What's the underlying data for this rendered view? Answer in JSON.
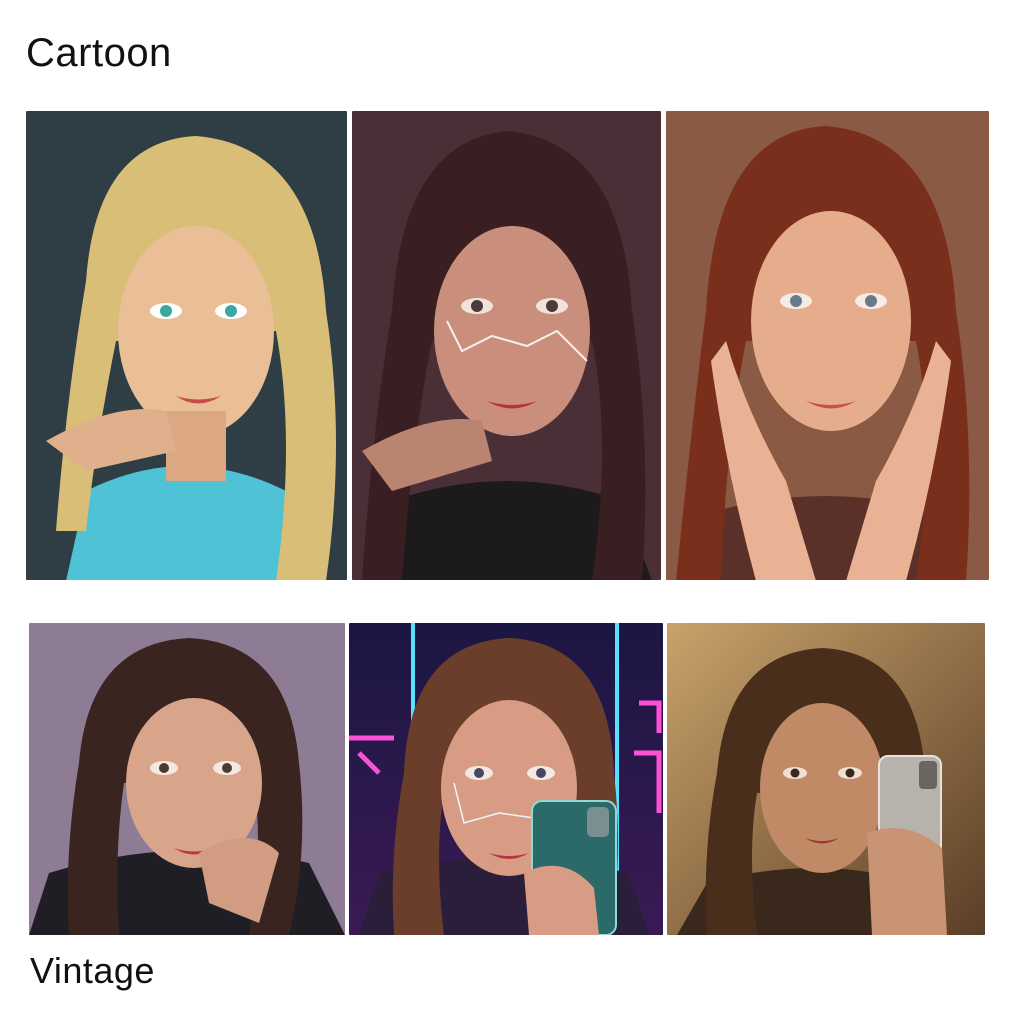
{
  "labels": {
    "top": "Cartoon",
    "bottom": "Vintage"
  },
  "tiles": [
    {
      "name": "blonde-freckles-portrait",
      "bg": "#2f3d45",
      "hair": "#d9be78",
      "skin": "#eabf97",
      "shirt": "#4fc2d6"
    },
    {
      "name": "brunette-cyber-lines-portrait",
      "bg": "#4a2f36",
      "hair": "#3a1f22",
      "skin": "#c98f7c",
      "shirt": "#1d1a1c"
    },
    {
      "name": "redhead-hands-on-cheeks-portrait",
      "bg": "#8a5a45",
      "hair": "#7a2f1c",
      "skin": "#e6ad8c",
      "shirt": "#5a3028"
    },
    {
      "name": "brunette-lilac-portrait",
      "bg": "#8e7c95",
      "hair": "#3a2420",
      "skin": "#d8a58a",
      "shirt": "#1f1e24"
    },
    {
      "name": "neon-selfie-portrait",
      "bg": "#1b1642",
      "hair": "#6a3e2a",
      "skin": "#d89c84",
      "shirt": "#2a1e3a",
      "neon_pink": "#ff4fd8",
      "neon_blue": "#58e1ff"
    },
    {
      "name": "sepia-selfie-portrait",
      "bg": "#8a6a44",
      "hair": "#4a2e1c",
      "skin": "#c08a66",
      "shirt": "#3a281c"
    }
  ]
}
